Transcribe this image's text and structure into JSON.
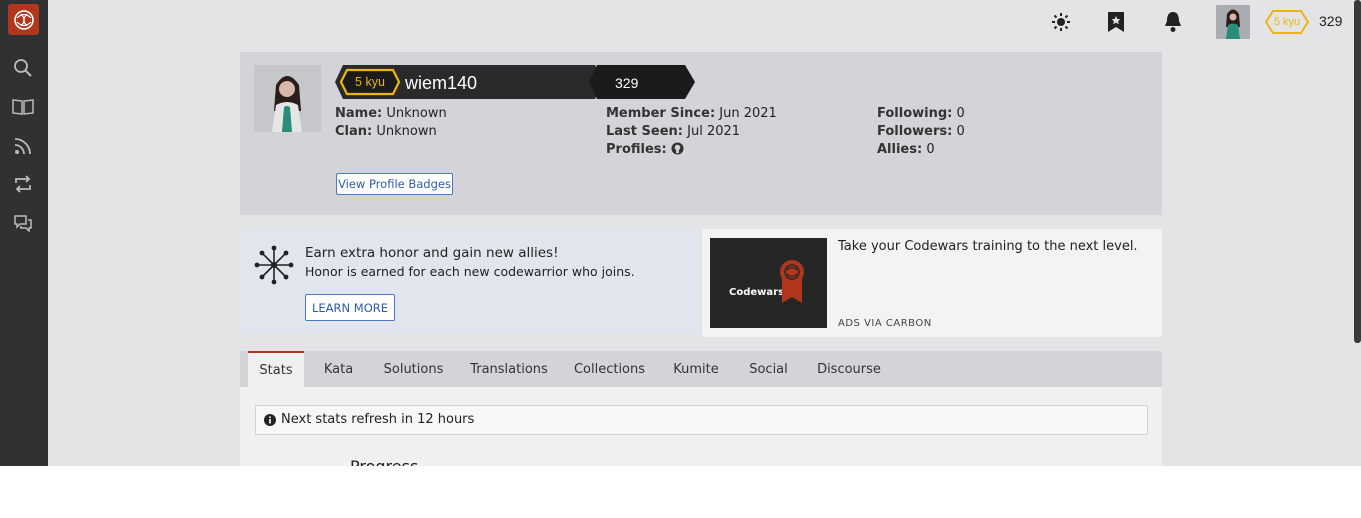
{
  "topbar": {
    "rank": "5 kyu",
    "honor": "329"
  },
  "profile": {
    "rank": "5 kyu",
    "username": "wiem140",
    "honor": "329",
    "name_label": "Name:",
    "name_value": "Unknown",
    "clan_label": "Clan:",
    "clan_value": "Unknown",
    "member_since_label": "Member Since:",
    "member_since_value": "Jun 2021",
    "last_seen_label": "Last Seen:",
    "last_seen_value": "Jul 2021",
    "profiles_label": "Profiles:",
    "following_label": "Following:",
    "following_value": "0",
    "followers_label": "Followers:",
    "followers_value": "0",
    "allies_label": "Allies:",
    "allies_value": "0",
    "badges_button": "View Profile Badges"
  },
  "promo": {
    "title": "Earn extra honor and gain new allies!",
    "subtitle": "Honor is earned for each new codewarrior who joins.",
    "button": "LEARN MORE"
  },
  "ad": {
    "image_text": "Codewars",
    "text": "Take your Codewars training to the next level.",
    "via": "ADS VIA CARBON"
  },
  "tabs": [
    "Stats",
    "Kata",
    "Solutions",
    "Translations",
    "Collections",
    "Kumite",
    "Social",
    "Discourse"
  ],
  "stats": {
    "notice": "Next stats refresh in 12 hours",
    "progress_title": "Progress"
  },
  "colors": {
    "brand": "#b1361e",
    "rank_yellow": "#ecb613",
    "sidebar": "#303133"
  }
}
